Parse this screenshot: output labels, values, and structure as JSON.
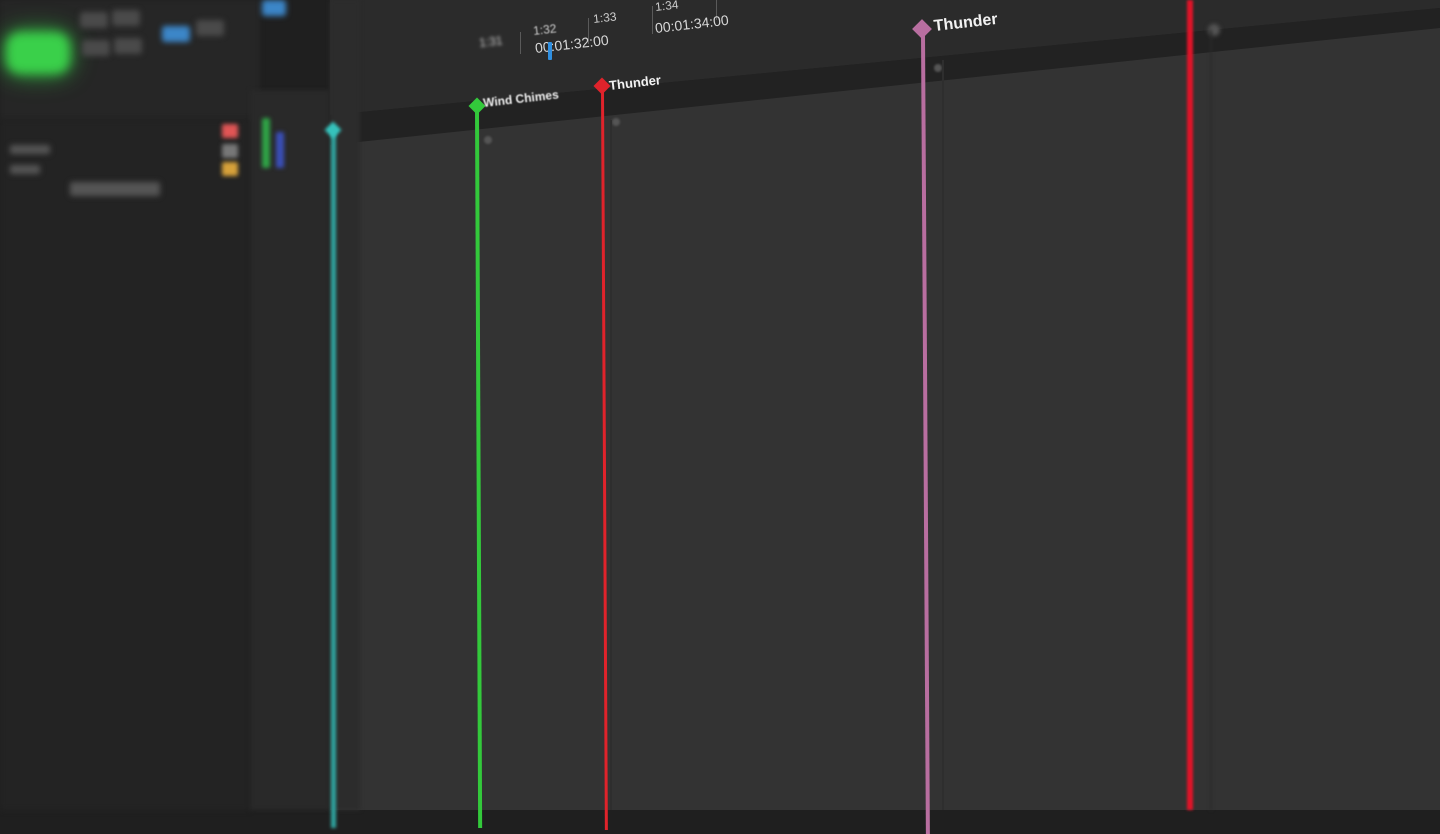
{
  "ruler": {
    "ticks": [
      "1:31",
      "1:32",
      "1:33",
      "1:34"
    ],
    "timecodes": [
      "00:01:32:00",
      "00:01:34:00"
    ]
  },
  "markers": [
    {
      "label": "Wind Chimes",
      "color": "#33c93b"
    },
    {
      "label": "Thunder",
      "color": "#e0232b"
    },
    {
      "label": "Thunder",
      "color": "#b86ea0"
    },
    {
      "label": "",
      "color": "#e01428"
    },
    {
      "label": "",
      "color": "#2fa5a0"
    }
  ],
  "colors": {
    "accent_blue": "#2f8fe0",
    "record_green": "#3ad04a",
    "timeline_bg": "#333333"
  }
}
